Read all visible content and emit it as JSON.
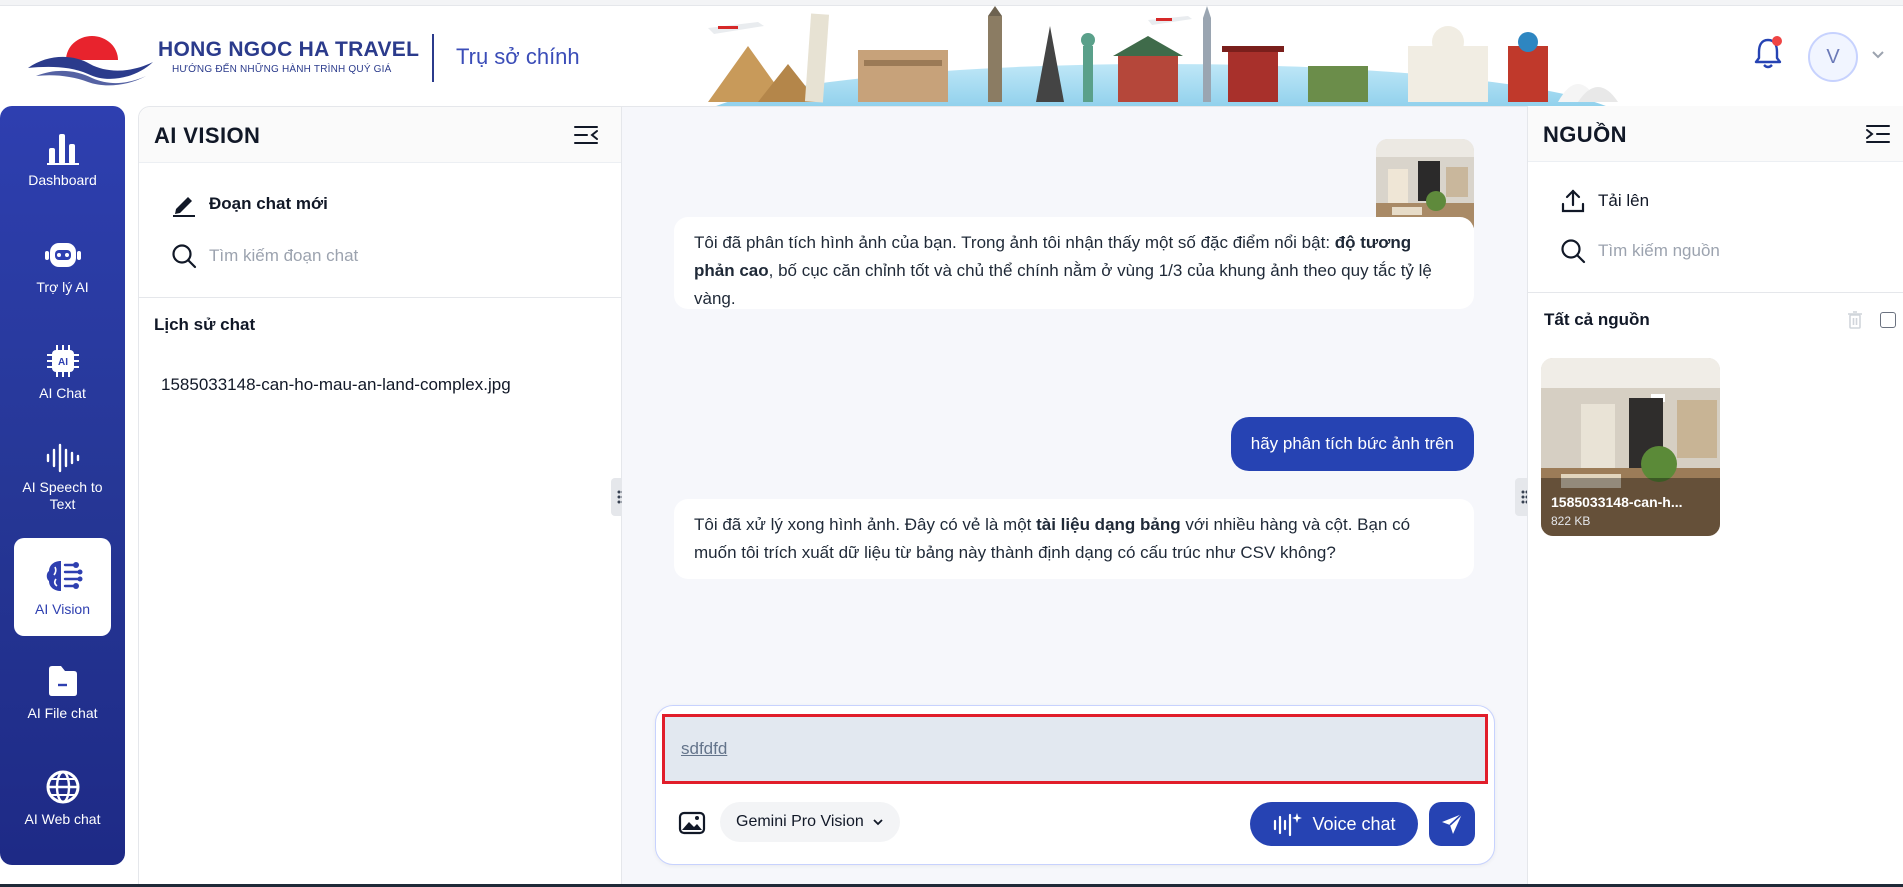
{
  "header": {
    "brand_name": "HONG NGOC HA TRAVEL",
    "brand_tagline": "HƯỚNG ĐẾN NHỮNG HÀNH TRÌNH QUÝ GIÁ",
    "branch": "Trụ sở chính",
    "avatar_letter": "V"
  },
  "nav": {
    "items": [
      {
        "label": "Dashboard",
        "icon": "bar-chart-icon"
      },
      {
        "label": "Trợ lý AI",
        "icon": "robot-icon"
      },
      {
        "label": "AI Chat",
        "icon": "ai-chip-icon"
      },
      {
        "label": "AI Speech to Text",
        "icon": "sound-wave-icon"
      },
      {
        "label": "AI Vision",
        "icon": "brain-icon",
        "active": true
      },
      {
        "label": "AI File chat",
        "icon": "folder-icon"
      },
      {
        "label": "AI Web chat",
        "icon": "globe-icon"
      }
    ]
  },
  "left_panel": {
    "title": "AI VISION",
    "new_chat_label": "Đoạn chat mới",
    "search_placeholder": "Tìm kiếm đoạn chat",
    "history_title": "Lịch sử chat",
    "history": [
      "1585033148-can-ho-mau-an-land-complex.jpg"
    ]
  },
  "chat": {
    "messages": [
      {
        "role": "assistant",
        "parts": [
          "Tôi đã phân tích hình ảnh của bạn. Trong ảnh tôi nhận thấy một số đặc điểm nổi bật: ",
          "độ tương phản cao",
          ", bố cục căn chỉnh tốt và chủ thể chính nằm ở vùng 1/3 của khung ảnh theo quy tắc tỷ lệ vàng."
        ]
      },
      {
        "role": "user",
        "text": "hãy phân tích bức ảnh trên"
      },
      {
        "role": "assistant",
        "parts": [
          "Tôi đã xử lý xong hình ảnh. Đây có vẻ là một ",
          "tài liệu dạng bảng",
          " với nhiều hàng và cột. Bạn có muốn tôi trích xuất dữ liệu từ bảng này thành định dạng có cấu trúc như CSV không?"
        ]
      }
    ],
    "input_value": "sdfdfd",
    "model": "Gemini Pro Vision",
    "voice_label": "Voice chat"
  },
  "right_panel": {
    "title": "NGUỒN",
    "upload_label": "Tải lên",
    "search_placeholder": "Tìm kiếm nguồn",
    "all_sources_label": "Tất cả nguồn",
    "sources": [
      {
        "name": "1585033148-can-h...",
        "size": "822 KB"
      }
    ]
  },
  "colors": {
    "primary": "#2643b3",
    "nav_gradient_top": "#2e3fb0",
    "highlight_border": "#e11d2a"
  }
}
